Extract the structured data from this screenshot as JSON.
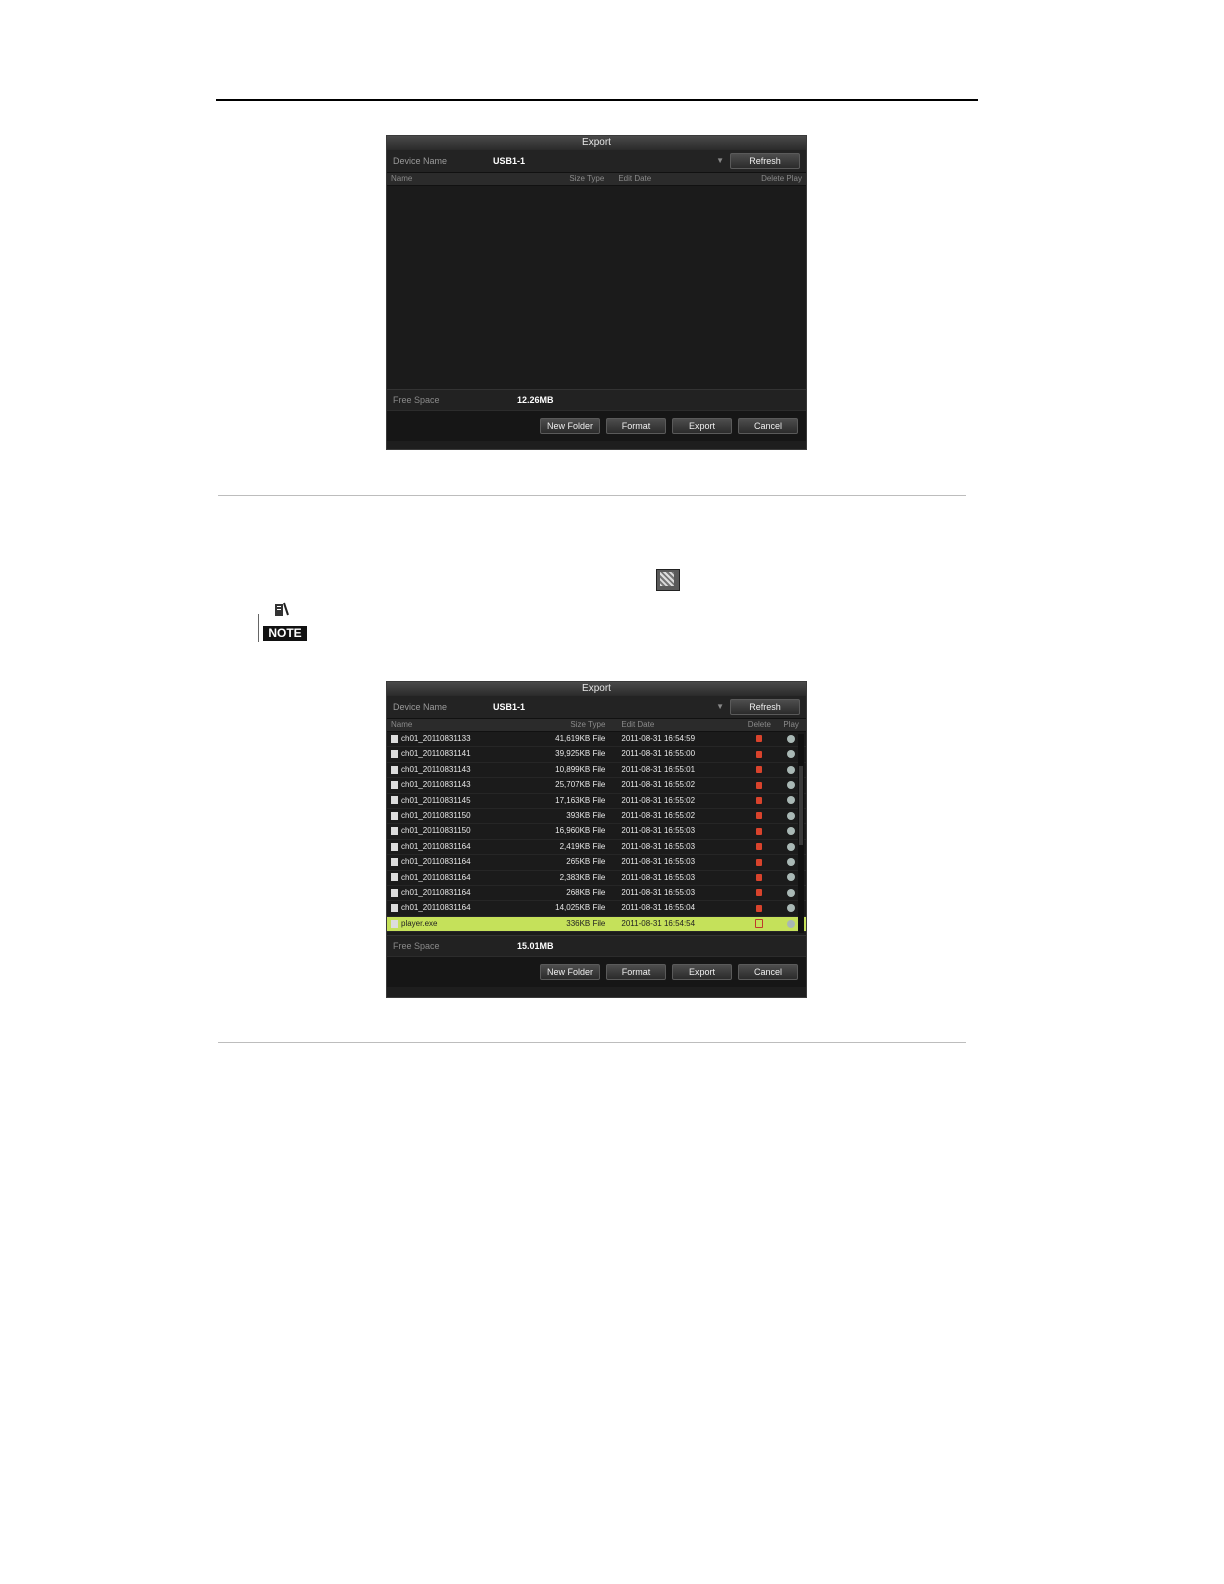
{
  "dialog1": {
    "title": "Export",
    "device_label": "Device Name",
    "device_value": "USB1-1",
    "refresh_label": "Refresh",
    "columns": [
      "Name",
      "Size Type",
      "Edit Date",
      "Delete Play"
    ],
    "free_label": "Free Space",
    "free_value": "12.26MB",
    "buttons": {
      "new_folder": "New Folder",
      "format": "Format",
      "export": "Export",
      "cancel": "Cancel"
    }
  },
  "dialog2": {
    "title": "Export",
    "device_label": "Device Name",
    "device_value": "USB1-1",
    "refresh_label": "Refresh",
    "columns": {
      "name": "Name",
      "size": "Size Type",
      "edit": "Edit Date",
      "del": "Delete",
      "play": "Play"
    },
    "rows": [
      {
        "name": "ch01_20110831133",
        "size": "41,619KB File",
        "date": "2011-08-31 16:54:59"
      },
      {
        "name": "ch01_20110831141",
        "size": "39,925KB File",
        "date": "2011-08-31 16:55:00"
      },
      {
        "name": "ch01_20110831143",
        "size": "10,899KB File",
        "date": "2011-08-31 16:55:01"
      },
      {
        "name": "ch01_20110831143",
        "size": "25,707KB File",
        "date": "2011-08-31 16:55:02"
      },
      {
        "name": "ch01_20110831145",
        "size": "17,163KB File",
        "date": "2011-08-31 16:55:02"
      },
      {
        "name": "ch01_20110831150",
        "size": "393KB File",
        "date": "2011-08-31 16:55:02"
      },
      {
        "name": "ch01_20110831150",
        "size": "16,960KB File",
        "date": "2011-08-31 16:55:03"
      },
      {
        "name": "ch01_20110831164",
        "size": "2,419KB File",
        "date": "2011-08-31 16:55:03"
      },
      {
        "name": "ch01_20110831164",
        "size": "265KB File",
        "date": "2011-08-31 16:55:03"
      },
      {
        "name": "ch01_20110831164",
        "size": "2,383KB File",
        "date": "2011-08-31 16:55:03"
      },
      {
        "name": "ch01_20110831164",
        "size": "268KB File",
        "date": "2011-08-31 16:55:03"
      },
      {
        "name": "ch01_20110831164",
        "size": "14,025KB File",
        "date": "2011-08-31 16:55:04"
      },
      {
        "name": "player.exe",
        "size": "336KB File",
        "date": "2011-08-31 16:54:54"
      }
    ],
    "selected_row": "player.exe",
    "free_label": "Free Space",
    "free_value": "15.01MB",
    "buttons": {
      "new_folder": "New Folder",
      "format": "Format",
      "export": "Export",
      "cancel": "Cancel"
    }
  },
  "note_label": "NOTE",
  "colors": {
    "selected_row": "#c5e15a",
    "dialog_bg": "#1e1e1e",
    "delete_icon": "#d9432c"
  }
}
